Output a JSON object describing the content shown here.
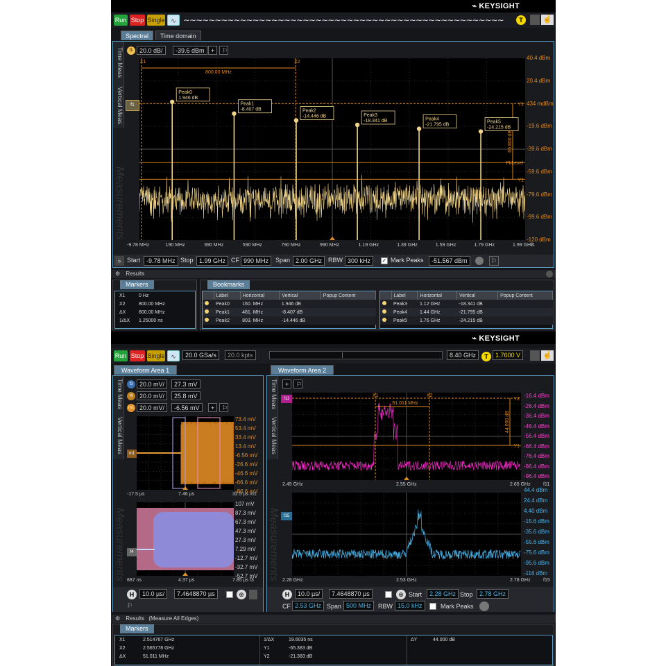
{
  "brand": "KEYSIGHT",
  "colors": {
    "trace_spec": "#f0d48a",
    "orange": "#e08a1e",
    "magenta": "#ff2ed0",
    "cyan": "#4ab3e8",
    "panel_border": "#5d9bc0",
    "run": "#24a33b",
    "stop": "#d22222",
    "single": "#c5a000"
  },
  "controls": {
    "run": "Run",
    "stop": "Stop",
    "single": "Single",
    "trigger_badge": "T"
  },
  "top": {
    "tabs": [
      "Spectral",
      "Time domain"
    ],
    "vtabs": [
      "Time Meas",
      "Vertical Meas"
    ],
    "watermark": "Measurements",
    "scale": {
      "icon": "f1",
      "per_div": "20.0 dB/",
      "offset": "-39.6 dBm",
      "add": "+"
    },
    "right_axis": [
      "40.4 dBm",
      "20.4 dBm",
      "434 mdBm",
      "-19.6 dBm",
      "-39.6 dBm",
      "-59.6 dBm",
      "-79.6 dBm",
      "-99.6 dBm",
      "-120 dBm"
    ],
    "bottom_axis": [
      "-9.78 MHz",
      "190 MHz",
      "390 MHz",
      "590 MHz",
      "790 MHz",
      "990 MHz",
      "1.19 GHz",
      "1.39 GHz",
      "1.59 GHz",
      "1.79 GHz",
      "1.99 GHz",
      "f1"
    ],
    "cursors": {
      "x1": "X1",
      "x2": "X2",
      "y1": "Y1",
      "y2": "Y2",
      "delta_x": "800.00 MHz",
      "delta_y": "66.800 dB",
      "pklevel": "PkLevel"
    },
    "peaks": [
      {
        "name": "Peak0",
        "value": "1.946 dB",
        "freq_mhz": 160,
        "level": 1.946
      },
      {
        "name": "Peak1",
        "value": "-8.407 dB",
        "freq_mhz": 481,
        "level": -8.407
      },
      {
        "name": "Peak2",
        "value": "-14.446 dB",
        "freq_mhz": 803,
        "level": -14.446
      },
      {
        "name": "Peak3",
        "value": "-18.341 dB",
        "freq_mhz": 1120,
        "level": -18.341
      },
      {
        "name": "Peak4",
        "value": "-21.795 dB",
        "freq_mhz": 1440,
        "level": -21.795
      },
      {
        "name": "Peak5",
        "value": "-24.215 dB",
        "freq_mhz": 1760,
        "level": -24.215
      }
    ],
    "footer": {
      "start_label": "Start",
      "start": "-9.78 MHz",
      "stop_label": "Stop",
      "stop": "1.99 GHz",
      "cf_label": "CF",
      "cf": "990 MHz",
      "span_label": "Span",
      "span": "2.00 GHz",
      "rbw_label": "RBW",
      "rbw": "300 kHz",
      "markpeaks_label": "Mark Peaks",
      "markpeaks_value": "-51.567 dBm"
    },
    "results": {
      "title": "Results",
      "markers_tab": "Markers",
      "bookmarks_tab": "Bookmarks",
      "markers": [
        [
          "X1",
          "0 Hz"
        ],
        [
          "X2",
          "800.00 MHz"
        ],
        [
          "ΔX",
          "800.00 MHz"
        ],
        [
          "1/ΔX",
          "1.25000 ns"
        ]
      ],
      "bm_headers": [
        "Label",
        "Horizontal",
        "Vertical",
        "Popup Content"
      ],
      "bm_left": [
        [
          "Peak0",
          "160. MHz",
          "1.946 dB"
        ],
        [
          "Peak1",
          "481. MHz",
          "-8.407 dB"
        ],
        [
          "Peak2",
          "803. MHz",
          "-14.446 dB"
        ]
      ],
      "bm_right": [
        [
          "Peak3",
          "1.12 GHz",
          "-18.341 dB"
        ],
        [
          "Peak4",
          "1.44 GHz",
          "-21.795 dB"
        ],
        [
          "Peak5",
          "1.76 GHz",
          "-24.215 dB"
        ]
      ]
    }
  },
  "bottom": {
    "acq": {
      "rate": "20.0 GSa/s",
      "pts": "20.0 kpts",
      "freq": "8.40 GHz",
      "trig": "T",
      "level": "1.7600 V"
    },
    "area1": {
      "tab": "Waveform Area 1",
      "chans": [
        {
          "icon": "f3",
          "scale": "20.0 mV/",
          "off": "27.3 mV"
        },
        {
          "icon": "f4",
          "scale": "20.0 mV/",
          "off": "25.8 mV"
        },
        {
          "icon": "m1",
          "scale": "20.0 mV/",
          "off": "-6.56 mV"
        }
      ],
      "upper_axis": [
        "73.4 mV",
        "53.4 mV",
        "33.4 mV",
        "13.4 mV",
        "-6.56 mV",
        "-26.6 mV",
        "-46.6 mV",
        "-66.6 mV",
        "-86.6 mV"
      ],
      "upper_time": [
        "-17.5 µs",
        "7.46 µs",
        "32.5 µs",
        "m1"
      ],
      "lower_axis": [
        "107 mV",
        "87.3 mV",
        "67.3 mV",
        "47.3 mV",
        "27.3 mV",
        "7.29 mV",
        "-12.7 mV",
        "-32.7 mV",
        "-52.7 mV"
      ],
      "lower_time": [
        "887 ns",
        "4.37 µs",
        "7.85 µs",
        "f3"
      ],
      "h_label": "H",
      "h_scale": "10.0 µs/",
      "h_pos": "7.4648870 µs"
    },
    "area2": {
      "tab": "Waveform Area 2",
      "upper_axis": [
        "-16.4 dBm",
        "-26.4 dBm",
        "-36.4 dBm",
        "-46.4 dBm",
        "-56.4 dBm",
        "-66.4 dBm",
        "-76.4 dBm",
        "-86.4 dBm",
        "-96.4 dBm"
      ],
      "upper_freq": [
        "2.45 GHz",
        "2.55 GHz",
        "2.65 GHz",
        "f11"
      ],
      "lower_axis": [
        "44.4 dBm",
        "24.4 dBm",
        "4.40 dBm",
        "-15.6 dBm",
        "-35.6 dBm",
        "-55.6 dBm",
        "-75.6 dBm",
        "-95.6 dBm",
        "-116 dBm"
      ],
      "lower_freq": [
        "2.28 GHz",
        "2.53 GHz",
        "2.78 GHz",
        "f15"
      ],
      "cursors": {
        "x1": "X1",
        "x2": "X2",
        "y1": "Y1",
        "y2": "Y2",
        "delta_x": "51.011 MHz",
        "delta_y": "44.000 dB"
      },
      "h_label": "H",
      "h_scale": "10.0 µs/",
      "h_pos": "7.4648870 µs",
      "start_label": "Start",
      "start": "2.28 GHz",
      "stop_label": "Stop",
      "stop": "2.78 GHz",
      "cf_label": "CF",
      "cf": "2.53 GHz",
      "span_label": "Span",
      "span": "500 MHz",
      "rbw_label": "RBW",
      "rbw": "15.0 kHz",
      "markpeaks_label": "Mark Peaks"
    },
    "results": {
      "title": "Results",
      "subtitle": "(Measure All Edges)",
      "markers_tab": "Markers",
      "col1": [
        [
          "X1",
          "2.514767 GHz"
        ],
        [
          "X2",
          "2.565778 GHz"
        ],
        [
          "ΔX",
          "51.011 MHz"
        ]
      ],
      "col2": [
        [
          "1/ΔX",
          "19.6035 ns"
        ],
        [
          "Y1",
          "-65.383 dB"
        ],
        [
          "Y2",
          "-21.383 dB"
        ]
      ],
      "col3": [
        [
          "ΔY",
          "44.000 dB"
        ]
      ]
    }
  }
}
